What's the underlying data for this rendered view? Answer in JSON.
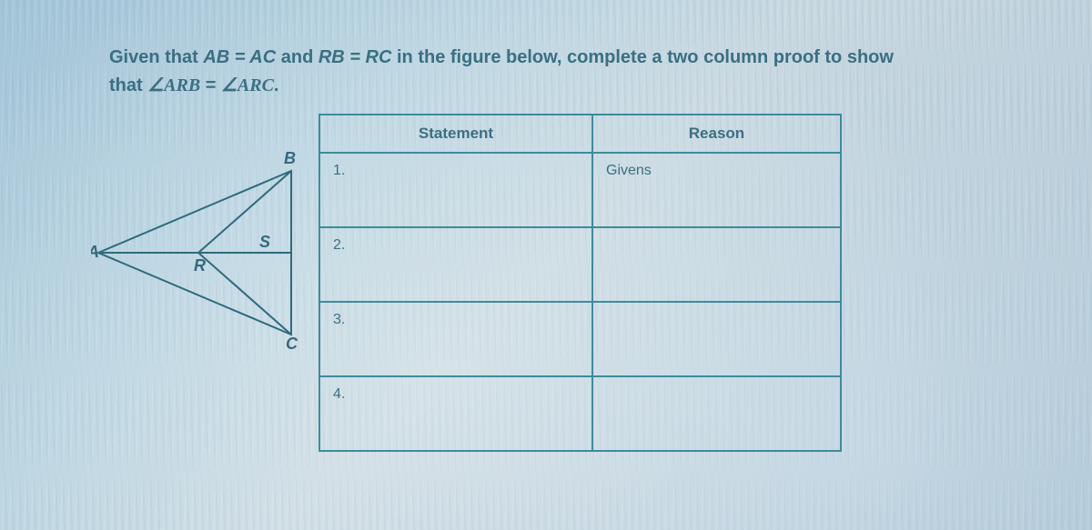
{
  "prompt": {
    "line1_a": "Given that ",
    "eq1": "AB = AC",
    "line1_b": " and ",
    "eq2": "RB = RC",
    "line1_c": " in the figure below, complete a two column proof to show",
    "line2_a": "that ",
    "eq3_lhs": "∠ARB",
    "eq3_mid": " = ",
    "eq3_rhs": "∠ARC",
    "line2_b": "."
  },
  "figure_labels": {
    "A": "A",
    "B": "B",
    "C": "C",
    "R": "R",
    "S": "S"
  },
  "table": {
    "headers": {
      "statement": "Statement",
      "reason": "Reason"
    },
    "rows": [
      {
        "num": "1.",
        "statement": "",
        "reason": "Givens"
      },
      {
        "num": "2.",
        "statement": "",
        "reason": ""
      },
      {
        "num": "3.",
        "statement": "",
        "reason": ""
      },
      {
        "num": "4.",
        "statement": "",
        "reason": ""
      }
    ]
  }
}
